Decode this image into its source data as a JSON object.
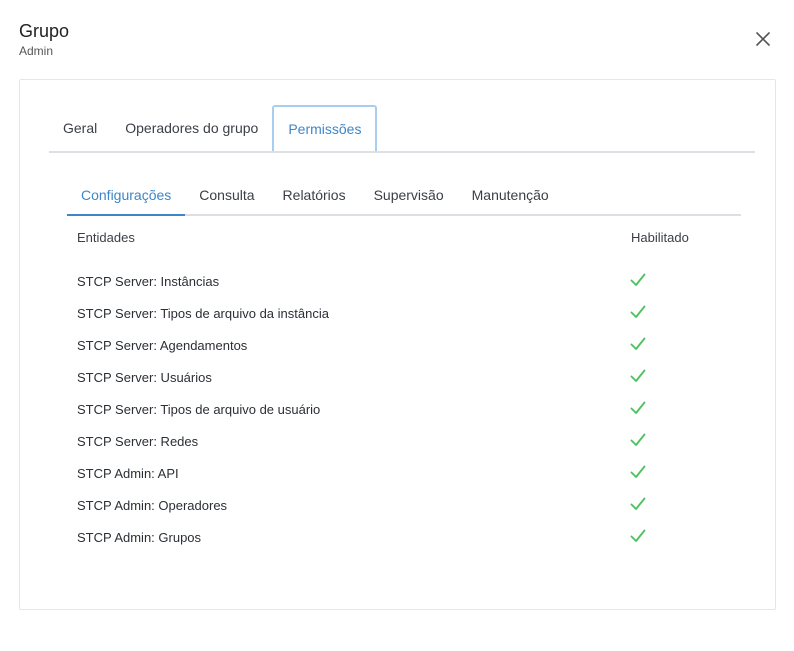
{
  "dialog": {
    "title": "Grupo",
    "subtitle": "Admin",
    "close_icon": "close-icon"
  },
  "main_tabs": [
    {
      "label": "Geral",
      "active": false
    },
    {
      "label": "Operadores do grupo",
      "active": false
    },
    {
      "label": "Permissões",
      "active": true
    }
  ],
  "sub_tabs": [
    {
      "label": "Configurações",
      "active": true
    },
    {
      "label": "Consulta",
      "active": false
    },
    {
      "label": "Relatórios",
      "active": false
    },
    {
      "label": "Supervisão",
      "active": false
    },
    {
      "label": "Manutenção",
      "active": false
    }
  ],
  "table": {
    "headers": {
      "entity": "Entidades",
      "enabled": "Habilitado"
    },
    "rows": [
      {
        "entity": "STCP Server: Instâncias",
        "enabled": true
      },
      {
        "entity": "STCP Server: Tipos de arquivo da instância",
        "enabled": true
      },
      {
        "entity": "STCP Server: Agendamentos",
        "enabled": true
      },
      {
        "entity": "STCP Server: Usuários",
        "enabled": true
      },
      {
        "entity": "STCP Server: Tipos de arquivo de usuário",
        "enabled": true
      },
      {
        "entity": "STCP Server: Redes",
        "enabled": true
      },
      {
        "entity": "STCP Admin: API",
        "enabled": true
      },
      {
        "entity": "STCP Admin: Operadores",
        "enabled": true
      },
      {
        "entity": "STCP Admin: Grupos",
        "enabled": true
      }
    ]
  },
  "colors": {
    "accent": "#3f86c8",
    "check": "#4cc05a",
    "border": "#dcdfe3"
  }
}
